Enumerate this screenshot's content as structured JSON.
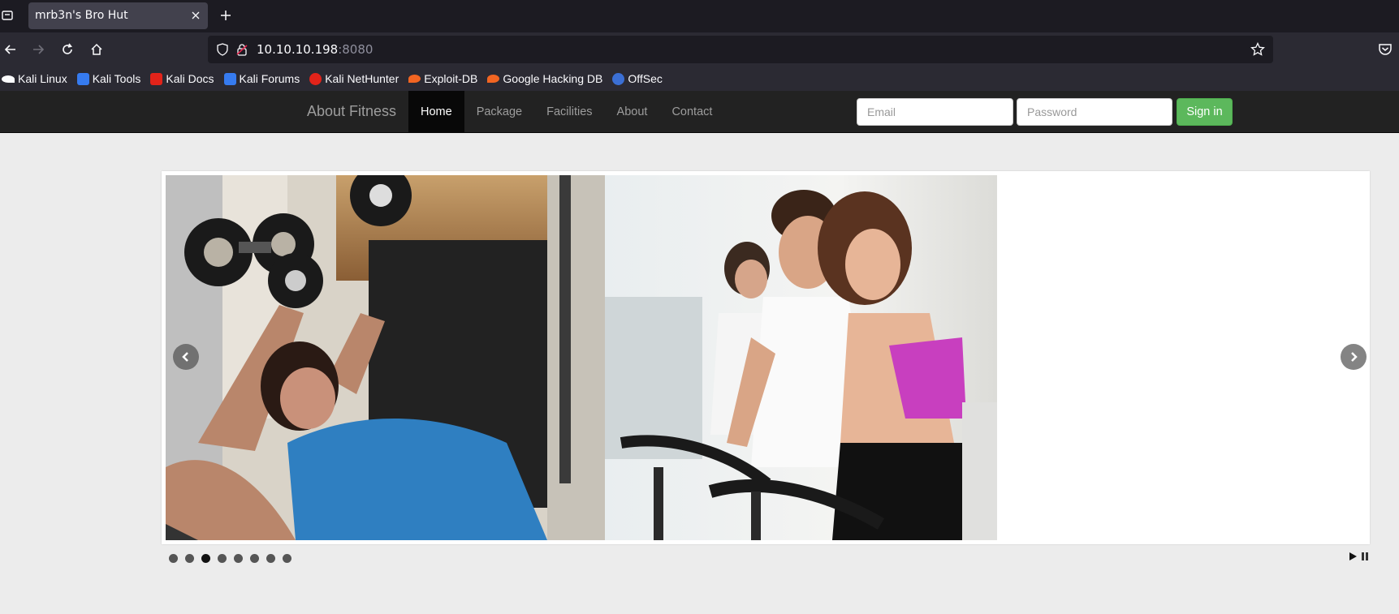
{
  "browser": {
    "tab_title": "mrb3n's Bro Hut",
    "url_host": "10.10.10.198",
    "url_port": ":8080",
    "bookmarks": [
      {
        "label": "Kali Linux",
        "icon": "kali-dragon-icon",
        "color": "#1c1b22"
      },
      {
        "label": "Kali Tools",
        "icon": "kali-tools-icon",
        "color": "#367bf0"
      },
      {
        "label": "Kali Docs",
        "icon": "kali-docs-icon",
        "color": "#e2231a"
      },
      {
        "label": "Kali Forums",
        "icon": "kali-forums-icon",
        "color": "#367bf0"
      },
      {
        "label": "Kali NetHunter",
        "icon": "nethunter-icon",
        "color": "#e2231a"
      },
      {
        "label": "Exploit-DB",
        "icon": "exploit-db-icon",
        "color": "#f26522"
      },
      {
        "label": "Google Hacking DB",
        "icon": "ghdb-icon",
        "color": "#f26522"
      },
      {
        "label": "OffSec",
        "icon": "offsec-icon",
        "color": "#3b6fd4"
      }
    ]
  },
  "site": {
    "brand": "About Fitness",
    "menu": [
      {
        "label": "Home",
        "active": true
      },
      {
        "label": "Package",
        "active": false
      },
      {
        "label": "Facilities",
        "active": false
      },
      {
        "label": "About",
        "active": false
      },
      {
        "label": "Contact",
        "active": false
      }
    ],
    "login": {
      "email_placeholder": "Email",
      "password_placeholder": "Password",
      "signin_label": "Sign in"
    },
    "colors": {
      "navbar": "#222222",
      "signin": "#5cb85c"
    }
  },
  "slider": {
    "dot_count": 8,
    "active_dot": 3,
    "slides": [
      "dumbbell-bench-press-photo",
      "spinning-class-photo"
    ]
  }
}
